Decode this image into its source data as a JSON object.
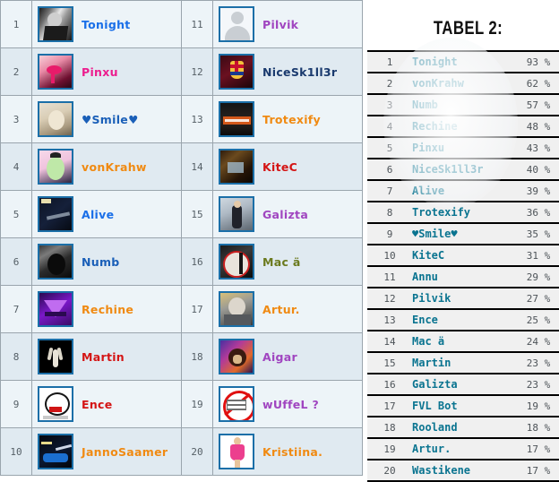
{
  "left_table": {
    "name": "photo-ranking-table",
    "column1": [
      {
        "rank": "1",
        "username": "Tonight",
        "color": "#1a6fe8",
        "avatar": "man-photo-bw"
      },
      {
        "rank": "2",
        "username": "Pinxu",
        "color": "#ec1e8e",
        "avatar": "pink-lips-illustration"
      },
      {
        "rank": "3",
        "username": "♥Smile♥",
        "color": "#1a5fb8",
        "avatar": "blonde-girl-photo"
      },
      {
        "rank": "4",
        "username": "vonKrahw",
        "color": "#f08a12",
        "avatar": "anime-green-hair"
      },
      {
        "rank": "5",
        "username": "Alive",
        "color": "#1a6fe8",
        "avatar": "dark-night-photo"
      },
      {
        "rank": "6",
        "username": "Numb",
        "color": "#1a5fb8",
        "avatar": "dark-couple-photo"
      },
      {
        "rank": "7",
        "username": "Rechine",
        "color": "#f08a12",
        "avatar": "purple-triangle-logo"
      },
      {
        "rank": "8",
        "username": "Martin",
        "color": "#d41515",
        "avatar": "white-hand-black-bg"
      },
      {
        "rank": "9",
        "username": "Ence",
        "color": "#d41515",
        "avatar": "troll-face-drawing"
      },
      {
        "rank": "10",
        "username": "JannoSaamer",
        "color": "#f08a12",
        "avatar": "blue-car-night"
      }
    ],
    "column2": [
      {
        "rank": "11",
        "username": "Pilvik",
        "color": "#a045c0",
        "avatar": "default-avatar-silhouette"
      },
      {
        "rank": "12",
        "username": "NiceSk1ll3r",
        "color": "#1a3a6e",
        "avatar": "fc-barcelona-crest"
      },
      {
        "rank": "13",
        "username": "Trotexify",
        "color": "#f08a12",
        "avatar": "trotexify-banner"
      },
      {
        "rank": "14",
        "username": "KiteC",
        "color": "#d41515",
        "avatar": "dark-room-photo"
      },
      {
        "rank": "15",
        "username": "Galizta",
        "color": "#a045c0",
        "avatar": "girl-mirror-selfie"
      },
      {
        "rank": "16",
        "username": "Mac ä",
        "color": "#6b7a1e",
        "avatar": "person-red-circle-sign"
      },
      {
        "rank": "17",
        "username": "Artur.",
        "color": "#f08a12",
        "avatar": "man-hood-photo"
      },
      {
        "rank": "18",
        "username": "Aigar",
        "color": "#a045c0",
        "avatar": "lion-roar-colorful"
      },
      {
        "rank": "19",
        "username": "wUffeL ?",
        "color": "#a045c0",
        "avatar": "no-photo-available"
      },
      {
        "rank": "20",
        "username": "Kristiina.",
        "color": "#f08a12",
        "avatar": "girl-pink-dress"
      }
    ]
  },
  "right_panel": {
    "title": "TABEL 2:",
    "rows": [
      {
        "rank": "1",
        "username": "Tonight",
        "percent": "93 %"
      },
      {
        "rank": "2",
        "username": "vonKrahw",
        "percent": "62 %"
      },
      {
        "rank": "3",
        "username": "Numb",
        "percent": "57 %"
      },
      {
        "rank": "4",
        "username": "Rechine",
        "percent": "48 %"
      },
      {
        "rank": "5",
        "username": "Pinxu",
        "percent": "43 %"
      },
      {
        "rank": "6",
        "username": "NiceSk1ll3r",
        "percent": "40 %"
      },
      {
        "rank": "7",
        "username": "Alive",
        "percent": "39 %"
      },
      {
        "rank": "8",
        "username": "Trotexify",
        "percent": "36 %"
      },
      {
        "rank": "9",
        "username": "♥Smile♥",
        "percent": "35 %"
      },
      {
        "rank": "10",
        "username": "KiteC",
        "percent": "31 %"
      },
      {
        "rank": "11",
        "username": "Annu",
        "percent": "29 %"
      },
      {
        "rank": "12",
        "username": "Pilvik",
        "percent": "27 %"
      },
      {
        "rank": "13",
        "username": "Ence",
        "percent": "25 %"
      },
      {
        "rank": "14",
        "username": "Mac ä",
        "percent": "24 %"
      },
      {
        "rank": "15",
        "username": "Martin",
        "percent": "23 %"
      },
      {
        "rank": "16",
        "username": "Galizta",
        "percent": "23 %"
      },
      {
        "rank": "17",
        "username": "FVL Bot",
        "percent": "19 %"
      },
      {
        "rank": "18",
        "username": "Rooland",
        "percent": "18 %"
      },
      {
        "rank": "19",
        "username": "Artur.",
        "percent": "17 %"
      },
      {
        "rank": "20",
        "username": "Wastikene",
        "percent": "17 %"
      }
    ]
  },
  "colors": {
    "row_light": "#edf4f8",
    "row_dark": "#e0eaf1",
    "cell_border": "#9aa5ad",
    "avatar_border": "#1b6fa8",
    "right_name": "#0a7490",
    "right_bg": "#f0f0f0",
    "right_rule": "#000000"
  }
}
